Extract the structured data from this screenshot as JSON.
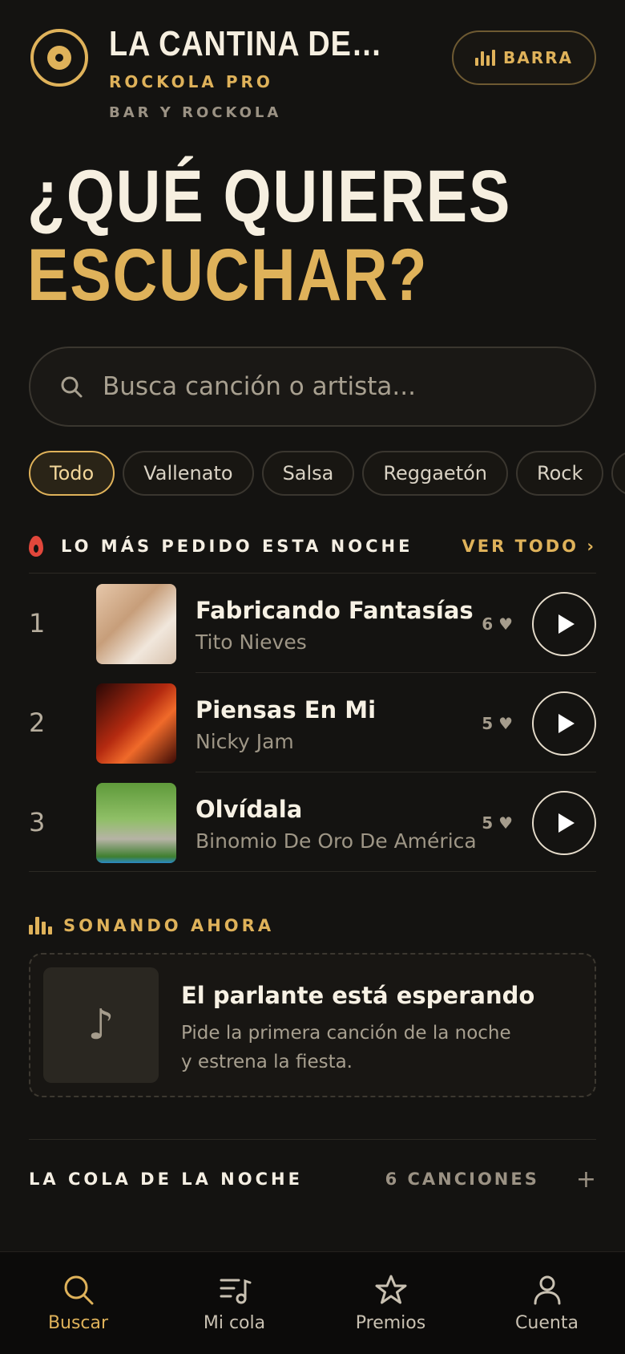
{
  "header": {
    "venue_name": "LA CANTINA DEL CENT…",
    "brand": "ROCKOLA PRO",
    "subtitle": "BAR Y ROCKOLA",
    "barra_label": "BARRA"
  },
  "hero": {
    "line1": "¿QUÉ QUIERES",
    "line2": "ESCUCHAR?"
  },
  "search": {
    "placeholder": "Busca canción o artista..."
  },
  "chips": [
    "Todo",
    "Vallenato",
    "Salsa",
    "Reggaetón",
    "Rock"
  ],
  "top_requested": {
    "title": "LO MÁS PEDIDO ESTA NOCHE",
    "see_all": "VER TODO ›",
    "songs": [
      {
        "rank": "1",
        "title": "Fabricando Fantasías",
        "artist": "Tito Nieves",
        "votes": "6 ♥"
      },
      {
        "rank": "2",
        "title": "Piensas En Mi",
        "artist": "Nicky Jam",
        "votes": "5 ♥"
      },
      {
        "rank": "3",
        "title": "Olvídala",
        "artist": "Binomio De Oro De América",
        "votes": "5 ♥"
      }
    ]
  },
  "now_playing": {
    "title": "SONANDO AHORA",
    "headline": "El parlante está esperando",
    "message": "Pide la primera canción de la noche y estrena la fiesta."
  },
  "queue": {
    "title": "LA COLA DE LA NOCHE",
    "count": "6 CANCIONES",
    "plus": "+"
  },
  "nav": {
    "items": [
      {
        "label": "Buscar",
        "icon": "search-icon"
      },
      {
        "label": "Mi cola",
        "icon": "queue-music-icon"
      },
      {
        "label": "Premios",
        "icon": "star-icon"
      },
      {
        "label": "Cuenta",
        "icon": "user-icon"
      }
    ]
  },
  "colors": {
    "background": "#141311",
    "accent_gold": "#dfb25a",
    "flame_red": "#e2473b"
  }
}
